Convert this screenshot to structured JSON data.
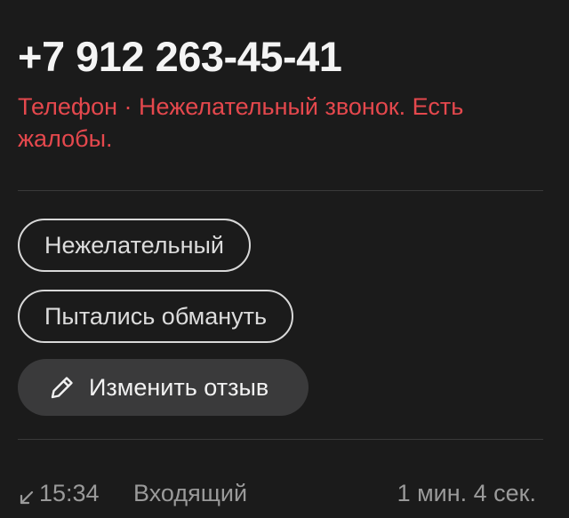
{
  "contact": {
    "phone": "+7 912 263-45-41",
    "description": "Телефон · Нежелательный звонок. Есть жалобы."
  },
  "tags": [
    {
      "label": "Нежелательный"
    },
    {
      "label": "Пытались обмануть"
    }
  ],
  "actions": {
    "edit_review_label": "Изменить отзыв",
    "edit_review_icon": "pencil-icon"
  },
  "call": {
    "direction_icon": "incoming-arrow-icon",
    "time": "15:34",
    "type": "Входящий",
    "duration": "1 мин. 4 сек."
  },
  "colors": {
    "background": "#1b1b1b",
    "warning": "#e5484d",
    "button_bg": "#3a3a3b",
    "muted_text": "#9a9a9a"
  }
}
